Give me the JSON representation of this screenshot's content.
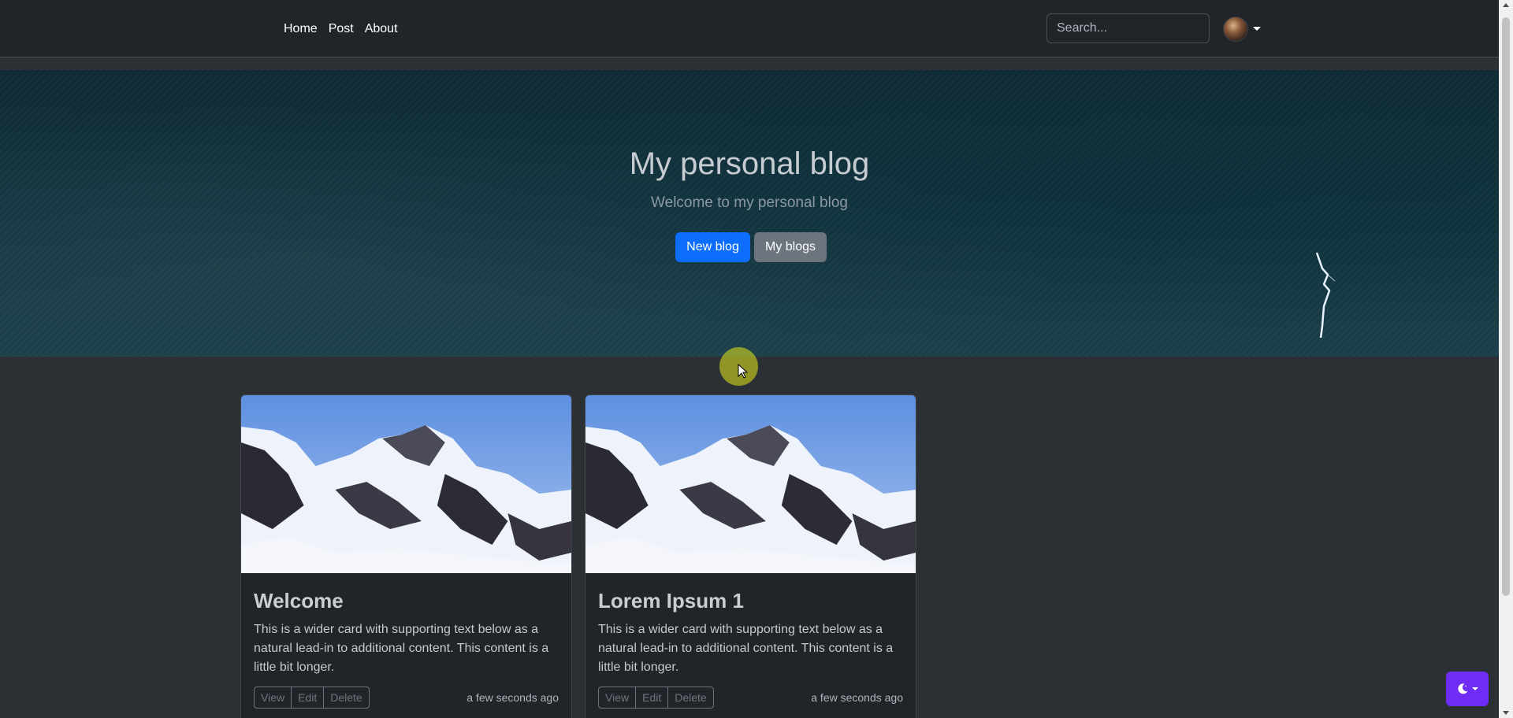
{
  "navbar": {
    "links": [
      {
        "label": "Home"
      },
      {
        "label": "Post"
      },
      {
        "label": "About"
      }
    ],
    "search": {
      "placeholder": "Search...",
      "value": ""
    }
  },
  "hero": {
    "title": "My personal blog",
    "subtitle": "Welcome to my personal blog",
    "buttons": {
      "new_blog": "New blog",
      "my_blogs": "My blogs"
    }
  },
  "posts": [
    {
      "title": "Welcome",
      "text": "This is a wider card with supporting text below as a natural lead-in to additional content. This content is a little bit longer.",
      "actions": {
        "view": "View",
        "edit": "Edit",
        "delete": "Delete"
      },
      "timestamp": "a few seconds ago"
    },
    {
      "title": "Lorem Ipsum 1",
      "text": "This is a wider card with supporting text below as a natural lead-in to additional content. This content is a little bit longer.",
      "actions": {
        "view": "View",
        "edit": "Edit",
        "delete": "Delete"
      },
      "timestamp": "a few seconds ago"
    }
  ],
  "icons": {
    "avatar": "user-avatar",
    "theme_toggle": "moon-icon",
    "card_image": "mountain-landscape"
  },
  "colors": {
    "navbar_bg": "#212529",
    "page_bg": "#2b3035",
    "primary": "#0d6efd",
    "secondary": "#6c757d",
    "theme_toggle": "#6f2cf5"
  }
}
